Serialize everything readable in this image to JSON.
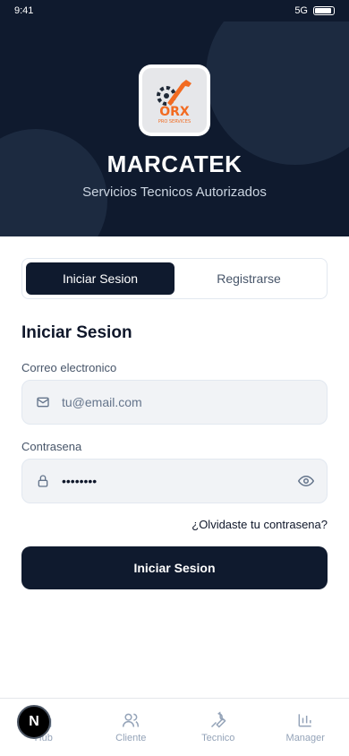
{
  "status": {
    "time": "9:41",
    "network": "5G",
    "battery_level": 0.9
  },
  "hero": {
    "brand": "MARCATEK",
    "tagline": "Servicios Tecnicos Autorizados",
    "logo_text": "ORX",
    "logo_sub": "PRO SERVICES"
  },
  "tabs": [
    {
      "label": "Iniciar Sesion",
      "active": true
    },
    {
      "label": "Registrarse",
      "active": false
    }
  ],
  "form": {
    "title": "Iniciar Sesion",
    "email_label": "Correo electronico",
    "email_placeholder": "tu@email.com",
    "password_label": "Contrasena",
    "password_value": "••••••••",
    "forgot": "¿Olvidaste tu contrasena?",
    "submit": "Iniciar Sesion"
  },
  "nav": [
    {
      "label": "Hub",
      "icon": "home-icon"
    },
    {
      "label": "Cliente",
      "icon": "users-icon"
    },
    {
      "label": "Tecnico",
      "icon": "wrench-icon"
    },
    {
      "label": "Manager",
      "icon": "bar-chart-icon"
    }
  ],
  "badge": {
    "letter": "N"
  },
  "colors": {
    "primary": "#0f1a2e",
    "accent": "#f26b21",
    "muted": "#94a3b8"
  }
}
